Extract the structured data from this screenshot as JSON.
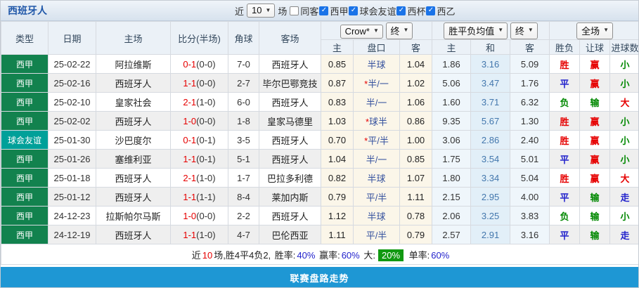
{
  "header": {
    "title": "西班牙人",
    "recent_label": "近",
    "recent_count": "10",
    "matches_label": "场",
    "checkboxes": [
      {
        "label": "同客",
        "checked": false
      },
      {
        "label": "西甲",
        "checked": true
      },
      {
        "label": "球会友谊",
        "checked": true
      },
      {
        "label": "西杯",
        "checked": true
      },
      {
        "label": "西乙",
        "checked": true
      }
    ],
    "checkbox_color": "#1A73E8"
  },
  "table": {
    "left_headers": [
      "类型",
      "日期",
      "主场",
      "比分(半场)",
      "角球",
      "客场"
    ],
    "selects": {
      "odds_source": "Crow*",
      "final1": "终",
      "avg_odds": "胜平负均值",
      "final2": "终",
      "scope": "全场"
    },
    "sub_headers": [
      "主",
      "盘口",
      "客",
      "主",
      "和",
      "客",
      "胜负",
      "让球",
      "进球数"
    ],
    "type_colors": {
      "西甲": "#12824E",
      "球会友谊": "#00A099"
    },
    "rows": [
      {
        "type": "西甲",
        "date": "25-02-22",
        "home": "阿拉维斯",
        "home_green": false,
        "score": "0-1",
        "half": "(0-0)",
        "corner": "7-0",
        "away": "西班牙人",
        "away_green": true,
        "h": "0.85",
        "star": false,
        "handicap": "半球",
        "a": "1.04",
        "avg_h": "1.86",
        "avg_d": "3.16",
        "avg_a": "5.09",
        "result": "胜",
        "handicap_result": "赢",
        "goals": "小"
      },
      {
        "type": "西甲",
        "date": "25-02-16",
        "home": "西班牙人",
        "home_green": true,
        "score": "1-1",
        "half": "(0-0)",
        "corner": "2-7",
        "away": "毕尔巴鄂竞技",
        "away_green": false,
        "h": "0.87",
        "star": true,
        "handicap": "半/一",
        "a": "1.02",
        "avg_h": "5.06",
        "avg_d": "3.47",
        "avg_a": "1.76",
        "result": "平",
        "handicap_result": "赢",
        "goals": "小"
      },
      {
        "type": "西甲",
        "date": "25-02-10",
        "home": "皇家社会",
        "home_green": false,
        "score": "2-1",
        "half": "(1-0)",
        "corner": "6-0",
        "away": "西班牙人",
        "away_green": true,
        "h": "0.83",
        "star": false,
        "handicap": "半/一",
        "a": "1.06",
        "avg_h": "1.60",
        "avg_d": "3.71",
        "avg_a": "6.32",
        "result": "负",
        "handicap_result": "输",
        "goals": "大"
      },
      {
        "type": "西甲",
        "date": "25-02-02",
        "home": "西班牙人",
        "home_green": true,
        "score": "1-0",
        "half": "(0-0)",
        "corner": "1-8",
        "away": "皇家马德里",
        "away_green": false,
        "h": "1.03",
        "star": true,
        "handicap": "球半",
        "a": "0.86",
        "avg_h": "9.35",
        "avg_d": "5.67",
        "avg_a": "1.30",
        "result": "胜",
        "handicap_result": "赢",
        "goals": "小"
      },
      {
        "type": "球会友谊",
        "date": "25-01-30",
        "home": "沙巴度尔",
        "home_green": false,
        "score": "0-1",
        "half": "(0-1)",
        "corner": "3-5",
        "away": "西班牙人",
        "away_green": true,
        "h": "0.70",
        "star": true,
        "handicap": "平/半",
        "a": "1.00",
        "avg_h": "3.06",
        "avg_d": "2.86",
        "avg_a": "2.40",
        "result": "胜",
        "handicap_result": "赢",
        "goals": "小"
      },
      {
        "type": "西甲",
        "date": "25-01-26",
        "home": "塞维利亚",
        "home_green": false,
        "score": "1-1",
        "half": "(0-1)",
        "corner": "5-1",
        "away": "西班牙人",
        "away_green": true,
        "h": "1.04",
        "star": false,
        "handicap": "半/一",
        "a": "0.85",
        "avg_h": "1.75",
        "avg_d": "3.54",
        "avg_a": "5.01",
        "result": "平",
        "handicap_result": "赢",
        "goals": "小"
      },
      {
        "type": "西甲",
        "date": "25-01-18",
        "home": "西班牙人",
        "home_green": true,
        "score": "2-1",
        "half": "(1-0)",
        "corner": "1-7",
        "away": "巴拉多利德",
        "away_green": false,
        "h": "0.82",
        "star": false,
        "handicap": "半球",
        "a": "1.07",
        "avg_h": "1.80",
        "avg_d": "3.34",
        "avg_a": "5.04",
        "result": "胜",
        "handicap_result": "赢",
        "goals": "大"
      },
      {
        "type": "西甲",
        "date": "25-01-12",
        "home": "西班牙人",
        "home_green": true,
        "score": "1-1",
        "half": "(1-1)",
        "corner": "8-4",
        "away": "莱加内斯",
        "away_green": false,
        "h": "0.79",
        "star": false,
        "handicap": "平/半",
        "a": "1.11",
        "avg_h": "2.15",
        "avg_d": "2.95",
        "avg_a": "4.00",
        "result": "平",
        "handicap_result": "输",
        "goals": "走"
      },
      {
        "type": "西甲",
        "date": "24-12-23",
        "home": "拉斯帕尔马斯",
        "home_green": false,
        "score": "1-0",
        "half": "(0-0)",
        "corner": "2-2",
        "away": "西班牙人",
        "away_green": true,
        "h": "1.12",
        "star": false,
        "handicap": "半球",
        "a": "0.78",
        "avg_h": "2.06",
        "avg_d": "3.25",
        "avg_a": "3.83",
        "result": "负",
        "handicap_result": "输",
        "goals": "小"
      },
      {
        "type": "西甲",
        "date": "24-12-19",
        "home": "西班牙人",
        "home_green": true,
        "score": "1-1",
        "half": "(1-0)",
        "corner": "4-7",
        "away": "巴伦西亚",
        "away_green": false,
        "h": "1.11",
        "star": false,
        "handicap": "平/半",
        "a": "0.79",
        "avg_h": "2.57",
        "avg_d": "2.91",
        "avg_a": "3.16",
        "result": "平",
        "handicap_result": "输",
        "goals": "走"
      }
    ]
  },
  "value_colors": {
    "胜": "red",
    "平": "blue",
    "负": "green",
    "赢": "red",
    "输": "green",
    "小": "green",
    "大": "red",
    "走": "blue"
  },
  "summary": {
    "recent_label": "近",
    "recent_count": "10",
    "record": "场,胜4平4负2,",
    "win_rate_label": "胜率:",
    "win_rate": "40%",
    "cover_label": "赢率:",
    "cover_rate": "60%",
    "big_label": "大:",
    "big_rate": "20%",
    "single_label": "单率:",
    "single_rate": "60%"
  },
  "footer": {
    "title": "联赛盘路走势",
    "bg": "#1E97D4"
  }
}
